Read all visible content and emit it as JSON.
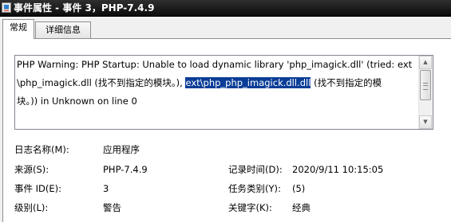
{
  "window": {
    "title": "事件属性 - 事件 3，PHP-7.4.9"
  },
  "tabs": [
    {
      "label": "常规"
    },
    {
      "label": "详细信息"
    }
  ],
  "message": {
    "lines": [
      "PHP Warning:  PHP Startup: Unable to load dynamic library 'php_imagick.dll' (tried: ext",
      "\\php_imagick.dll (找不到指定的模块。), ",
      "块。)) in Unknown on line 0"
    ],
    "selected_text": "ext\\php_php_imagick.dll.dll",
    "line2_after_selection": " (找不到指定的模"
  },
  "fields": {
    "log_name": {
      "label": "日志名称(M):",
      "value": "应用程序"
    },
    "source": {
      "label": "来源(S):",
      "value": "PHP-7.4.9"
    },
    "logged": {
      "label": "记录时间(D):",
      "value": "2020/9/11 10:15:05"
    },
    "event_id": {
      "label": "事件 ID(E):",
      "value": "3"
    },
    "task_category": {
      "label": "任务类别(Y):",
      "value": "(5)"
    },
    "level": {
      "label": "级别(L):",
      "value": "警告"
    },
    "keywords": {
      "label": "关键字(K):",
      "value": "经典"
    }
  },
  "icons": {
    "app": "event-viewer-icon",
    "scroll_up": "scroll-up-arrow-icon",
    "scroll_down": "scroll-down-arrow-icon"
  }
}
